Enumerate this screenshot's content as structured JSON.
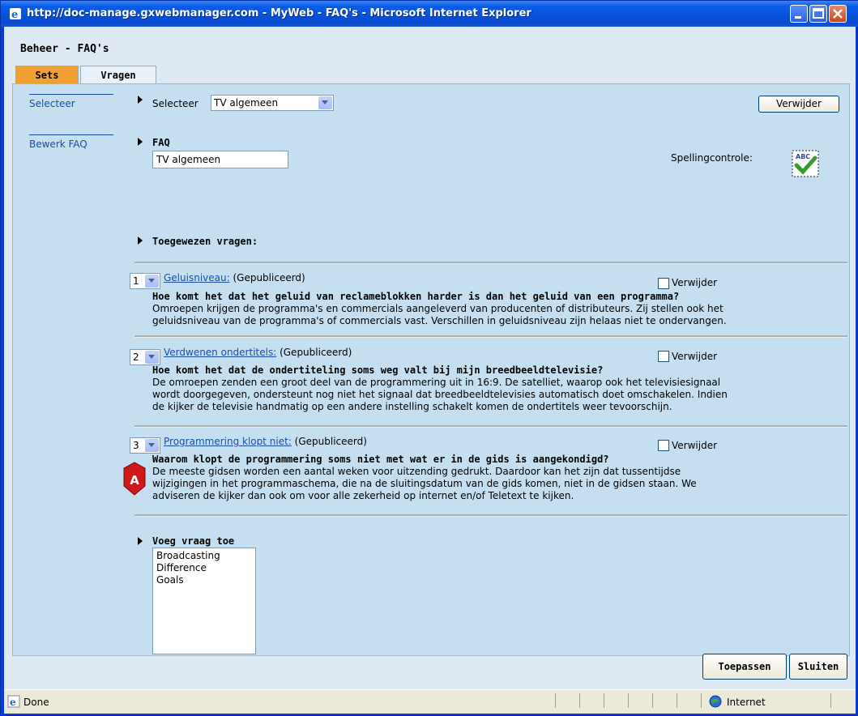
{
  "window": {
    "title": "http://doc-manage.gxwebmanager.com - MyWeb - FAQ's - Microsoft Internet Explorer"
  },
  "app": {
    "title": "Beheer - FAQ's"
  },
  "tabs": [
    {
      "label": "Sets",
      "active": true
    },
    {
      "label": "Vragen",
      "active": false
    }
  ],
  "sidebar": {
    "items": [
      {
        "label": "Selecteer"
      },
      {
        "label": "Bewerk FAQ"
      }
    ]
  },
  "select_section": {
    "label": "Selecteer",
    "selected": "TV algemeen",
    "delete_button": "Verwijder"
  },
  "faq_section": {
    "label": "FAQ",
    "value": "TV algemeen",
    "spellcheck_label": "Spellingcontrole:"
  },
  "assigned": {
    "label": "Toegewezen vragen:"
  },
  "questions": [
    {
      "order": "1",
      "link": "Geluisniveau:",
      "status": "(Gepubliceerd)",
      "delete_label": "Verwijder",
      "title": "Hoe komt het dat het geluid van reclameblokken harder is dan het geluid van een programma?",
      "lines": [
        "Omroepen krijgen de programma's en commercials aangeleverd van producenten of distributeurs. Zij stellen ook het",
        "geluidsniveau van de programma's of commercials vast. Verschillen in geluidsniveau zijn helaas niet te ondervangen."
      ]
    },
    {
      "order": "2",
      "link": "Verdwenen ondertitels:",
      "status": "(Gepubliceerd)",
      "delete_label": "Verwijder",
      "title": "Hoe komt het dat de ondertiteling soms weg valt bij mijn breedbeeldtelevisie?",
      "lines": [
        "De omroepen zenden een groot deel van de programmering uit in 16:9. De satelliet, waarop ook het televisiesignaal",
        "wordt doorgegeven, ondersteunt nog niet het signaal dat breedbeeldtelevisies automatisch doet omschakelen. Indien",
        "de kijker de televisie handmatig op een andere instelling schakelt komen de ondertitels weer tevoorschijn."
      ]
    },
    {
      "order": "3",
      "link": "Programmering klopt niet:",
      "status": "(Gepubliceerd)",
      "delete_label": "Verwijder",
      "title": "Waarom klopt de programmering soms niet met wat er in de gids is aangekondigd?",
      "lines": [
        "De meeste gidsen worden een aantal weken voor uitzending gedrukt. Daardoor kan het zijn dat tussentijdse",
        "wijzigingen in het programmaschema, die na de sluitingsdatum van de gids komen, niet in de gidsen staan. We",
        "adviseren de kijker dan ook om voor alle zekerheid op internet en/of Teletext te kijken."
      ]
    }
  ],
  "marker": {
    "label": "A"
  },
  "add_question": {
    "label": "Voeg vraag toe",
    "options": [
      "Broadcasting",
      "Difference",
      "Goals"
    ]
  },
  "footer": {
    "apply": "Toepassen",
    "close": "Sluiten"
  },
  "statusbar": {
    "text": "Done",
    "zone": "Internet"
  }
}
